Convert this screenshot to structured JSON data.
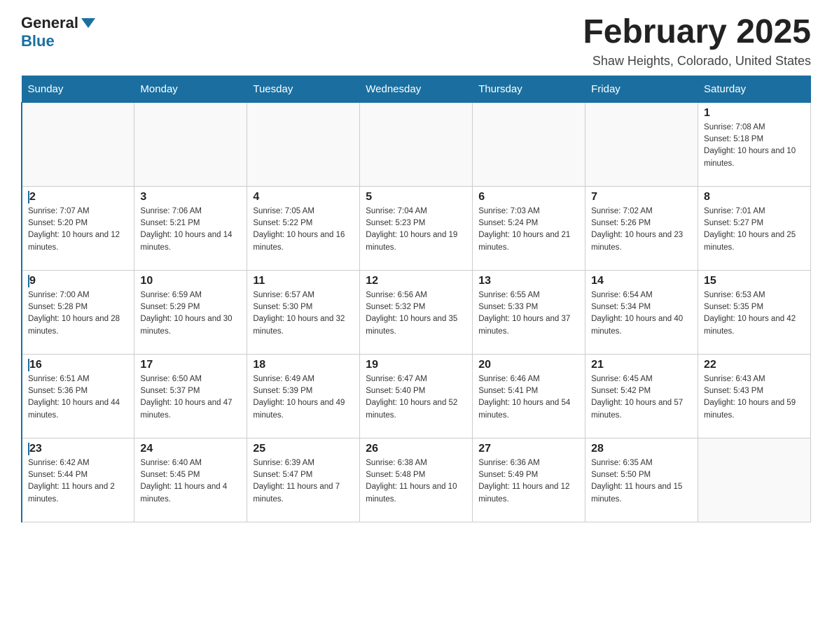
{
  "header": {
    "logo_general": "General",
    "logo_blue": "Blue",
    "month_title": "February 2025",
    "location": "Shaw Heights, Colorado, United States"
  },
  "days_of_week": [
    "Sunday",
    "Monday",
    "Tuesday",
    "Wednesday",
    "Thursday",
    "Friday",
    "Saturday"
  ],
  "weeks": [
    [
      {
        "day": "",
        "sunrise": "",
        "sunset": "",
        "daylight": "",
        "empty": true
      },
      {
        "day": "",
        "sunrise": "",
        "sunset": "",
        "daylight": "",
        "empty": true
      },
      {
        "day": "",
        "sunrise": "",
        "sunset": "",
        "daylight": "",
        "empty": true
      },
      {
        "day": "",
        "sunrise": "",
        "sunset": "",
        "daylight": "",
        "empty": true
      },
      {
        "day": "",
        "sunrise": "",
        "sunset": "",
        "daylight": "",
        "empty": true
      },
      {
        "day": "",
        "sunrise": "",
        "sunset": "",
        "daylight": "",
        "empty": true
      },
      {
        "day": "1",
        "sunrise": "Sunrise: 7:08 AM",
        "sunset": "Sunset: 5:18 PM",
        "daylight": "Daylight: 10 hours and 10 minutes.",
        "empty": false
      }
    ],
    [
      {
        "day": "2",
        "sunrise": "Sunrise: 7:07 AM",
        "sunset": "Sunset: 5:20 PM",
        "daylight": "Daylight: 10 hours and 12 minutes.",
        "empty": false
      },
      {
        "day": "3",
        "sunrise": "Sunrise: 7:06 AM",
        "sunset": "Sunset: 5:21 PM",
        "daylight": "Daylight: 10 hours and 14 minutes.",
        "empty": false
      },
      {
        "day": "4",
        "sunrise": "Sunrise: 7:05 AM",
        "sunset": "Sunset: 5:22 PM",
        "daylight": "Daylight: 10 hours and 16 minutes.",
        "empty": false
      },
      {
        "day": "5",
        "sunrise": "Sunrise: 7:04 AM",
        "sunset": "Sunset: 5:23 PM",
        "daylight": "Daylight: 10 hours and 19 minutes.",
        "empty": false
      },
      {
        "day": "6",
        "sunrise": "Sunrise: 7:03 AM",
        "sunset": "Sunset: 5:24 PM",
        "daylight": "Daylight: 10 hours and 21 minutes.",
        "empty": false
      },
      {
        "day": "7",
        "sunrise": "Sunrise: 7:02 AM",
        "sunset": "Sunset: 5:26 PM",
        "daylight": "Daylight: 10 hours and 23 minutes.",
        "empty": false
      },
      {
        "day": "8",
        "sunrise": "Sunrise: 7:01 AM",
        "sunset": "Sunset: 5:27 PM",
        "daylight": "Daylight: 10 hours and 25 minutes.",
        "empty": false
      }
    ],
    [
      {
        "day": "9",
        "sunrise": "Sunrise: 7:00 AM",
        "sunset": "Sunset: 5:28 PM",
        "daylight": "Daylight: 10 hours and 28 minutes.",
        "empty": false
      },
      {
        "day": "10",
        "sunrise": "Sunrise: 6:59 AM",
        "sunset": "Sunset: 5:29 PM",
        "daylight": "Daylight: 10 hours and 30 minutes.",
        "empty": false
      },
      {
        "day": "11",
        "sunrise": "Sunrise: 6:57 AM",
        "sunset": "Sunset: 5:30 PM",
        "daylight": "Daylight: 10 hours and 32 minutes.",
        "empty": false
      },
      {
        "day": "12",
        "sunrise": "Sunrise: 6:56 AM",
        "sunset": "Sunset: 5:32 PM",
        "daylight": "Daylight: 10 hours and 35 minutes.",
        "empty": false
      },
      {
        "day": "13",
        "sunrise": "Sunrise: 6:55 AM",
        "sunset": "Sunset: 5:33 PM",
        "daylight": "Daylight: 10 hours and 37 minutes.",
        "empty": false
      },
      {
        "day": "14",
        "sunrise": "Sunrise: 6:54 AM",
        "sunset": "Sunset: 5:34 PM",
        "daylight": "Daylight: 10 hours and 40 minutes.",
        "empty": false
      },
      {
        "day": "15",
        "sunrise": "Sunrise: 6:53 AM",
        "sunset": "Sunset: 5:35 PM",
        "daylight": "Daylight: 10 hours and 42 minutes.",
        "empty": false
      }
    ],
    [
      {
        "day": "16",
        "sunrise": "Sunrise: 6:51 AM",
        "sunset": "Sunset: 5:36 PM",
        "daylight": "Daylight: 10 hours and 44 minutes.",
        "empty": false
      },
      {
        "day": "17",
        "sunrise": "Sunrise: 6:50 AM",
        "sunset": "Sunset: 5:37 PM",
        "daylight": "Daylight: 10 hours and 47 minutes.",
        "empty": false
      },
      {
        "day": "18",
        "sunrise": "Sunrise: 6:49 AM",
        "sunset": "Sunset: 5:39 PM",
        "daylight": "Daylight: 10 hours and 49 minutes.",
        "empty": false
      },
      {
        "day": "19",
        "sunrise": "Sunrise: 6:47 AM",
        "sunset": "Sunset: 5:40 PM",
        "daylight": "Daylight: 10 hours and 52 minutes.",
        "empty": false
      },
      {
        "day": "20",
        "sunrise": "Sunrise: 6:46 AM",
        "sunset": "Sunset: 5:41 PM",
        "daylight": "Daylight: 10 hours and 54 minutes.",
        "empty": false
      },
      {
        "day": "21",
        "sunrise": "Sunrise: 6:45 AM",
        "sunset": "Sunset: 5:42 PM",
        "daylight": "Daylight: 10 hours and 57 minutes.",
        "empty": false
      },
      {
        "day": "22",
        "sunrise": "Sunrise: 6:43 AM",
        "sunset": "Sunset: 5:43 PM",
        "daylight": "Daylight: 10 hours and 59 minutes.",
        "empty": false
      }
    ],
    [
      {
        "day": "23",
        "sunrise": "Sunrise: 6:42 AM",
        "sunset": "Sunset: 5:44 PM",
        "daylight": "Daylight: 11 hours and 2 minutes.",
        "empty": false
      },
      {
        "day": "24",
        "sunrise": "Sunrise: 6:40 AM",
        "sunset": "Sunset: 5:45 PM",
        "daylight": "Daylight: 11 hours and 4 minutes.",
        "empty": false
      },
      {
        "day": "25",
        "sunrise": "Sunrise: 6:39 AM",
        "sunset": "Sunset: 5:47 PM",
        "daylight": "Daylight: 11 hours and 7 minutes.",
        "empty": false
      },
      {
        "day": "26",
        "sunrise": "Sunrise: 6:38 AM",
        "sunset": "Sunset: 5:48 PM",
        "daylight": "Daylight: 11 hours and 10 minutes.",
        "empty": false
      },
      {
        "day": "27",
        "sunrise": "Sunrise: 6:36 AM",
        "sunset": "Sunset: 5:49 PM",
        "daylight": "Daylight: 11 hours and 12 minutes.",
        "empty": false
      },
      {
        "day": "28",
        "sunrise": "Sunrise: 6:35 AM",
        "sunset": "Sunset: 5:50 PM",
        "daylight": "Daylight: 11 hours and 15 minutes.",
        "empty": false
      },
      {
        "day": "",
        "sunrise": "",
        "sunset": "",
        "daylight": "",
        "empty": true
      }
    ]
  ]
}
